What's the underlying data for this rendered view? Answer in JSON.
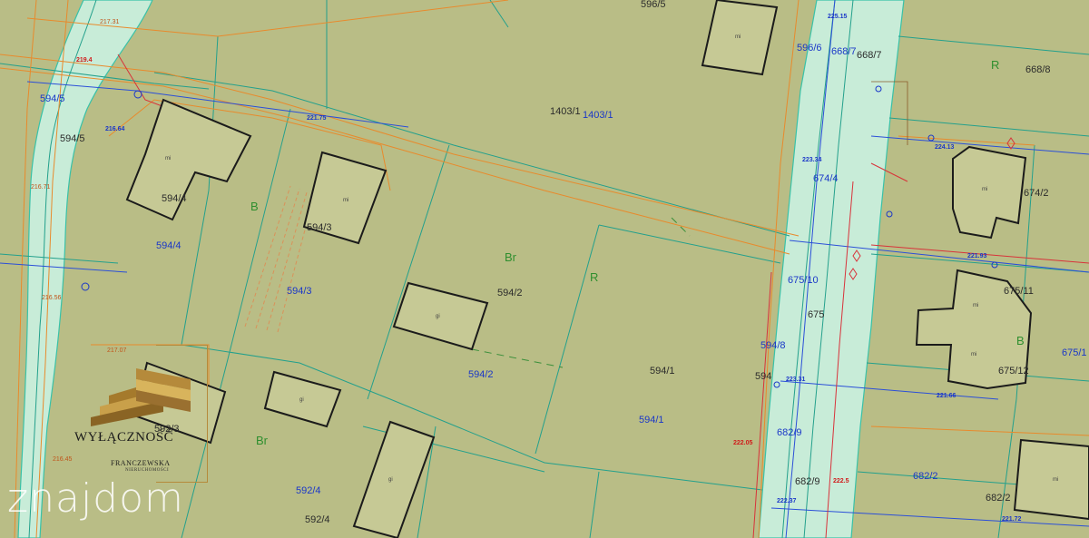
{
  "parcels": {
    "p596_5": "596/5",
    "p596_6": "596/6",
    "p668_7a": "668/7",
    "p668_7b": "668/7",
    "p668_8": "668/8",
    "p594_5a": "594/5",
    "p594_5b": "594/5",
    "p1403_1a": "1403/1",
    "p1403_1b": "1403/1",
    "p594_4a": "594/4",
    "p594_4b": "594/4",
    "p594_3a": "594/3",
    "p594_3b": "594/3",
    "p674_4": "674/4",
    "p674_2": "674/2",
    "p675_10": "675/10",
    "p675_11": "675/11",
    "p675_12": "675/12",
    "p675_1": "675/1",
    "p594_2a": "594/2",
    "p594_2b": "594/2",
    "p594_1a": "594/1",
    "p594_1b": "594/1",
    "p594_8": "594/8",
    "p594_x": "594",
    "p682_9a": "682/9",
    "p682_9b": "682/9",
    "p682_2a": "682/2",
    "p682_2b": "682/2",
    "p592_3": "592/3",
    "p592_4a": "592/4",
    "p592_4b": "592/4",
    "p675_x": "675"
  },
  "land_use": {
    "r_top_right": "R",
    "b_middle": "B",
    "br_center": "Br",
    "r_center": "R",
    "b_right": "B",
    "br_bottom": "Br"
  },
  "elevations": {
    "e1": "217.31",
    "e2": "219.4",
    "e3": "221.75",
    "e4": "216.64",
    "e5": "216.71",
    "e6": "216.56",
    "e7": "217.07",
    "e8": "216.45",
    "e9": "221.66",
    "e10": "222.5",
    "e11": "225.15",
    "e12": "223.34",
    "e13": "222.05",
    "e14": "221.93",
    "e15": "224.13",
    "e16": "223.31",
    "e17": "221.72",
    "e18": "222.37"
  },
  "logo": {
    "main": "WYŁĄCZNOŚĆ",
    "sub": "FRANCZEWSKA",
    "sub2": "NIERUCHOMOŚCI"
  },
  "watermark": "znajdom",
  "colors": {
    "background": "#b9bd86",
    "road": "#c8ecd8",
    "parcel_line": "#23a08c",
    "building": "#c6c995",
    "utility_orange": "#e88a2c",
    "utility_blue": "#2b4fd8",
    "utility_red": "#d8323a",
    "logo_gold": "#b58a3b"
  }
}
